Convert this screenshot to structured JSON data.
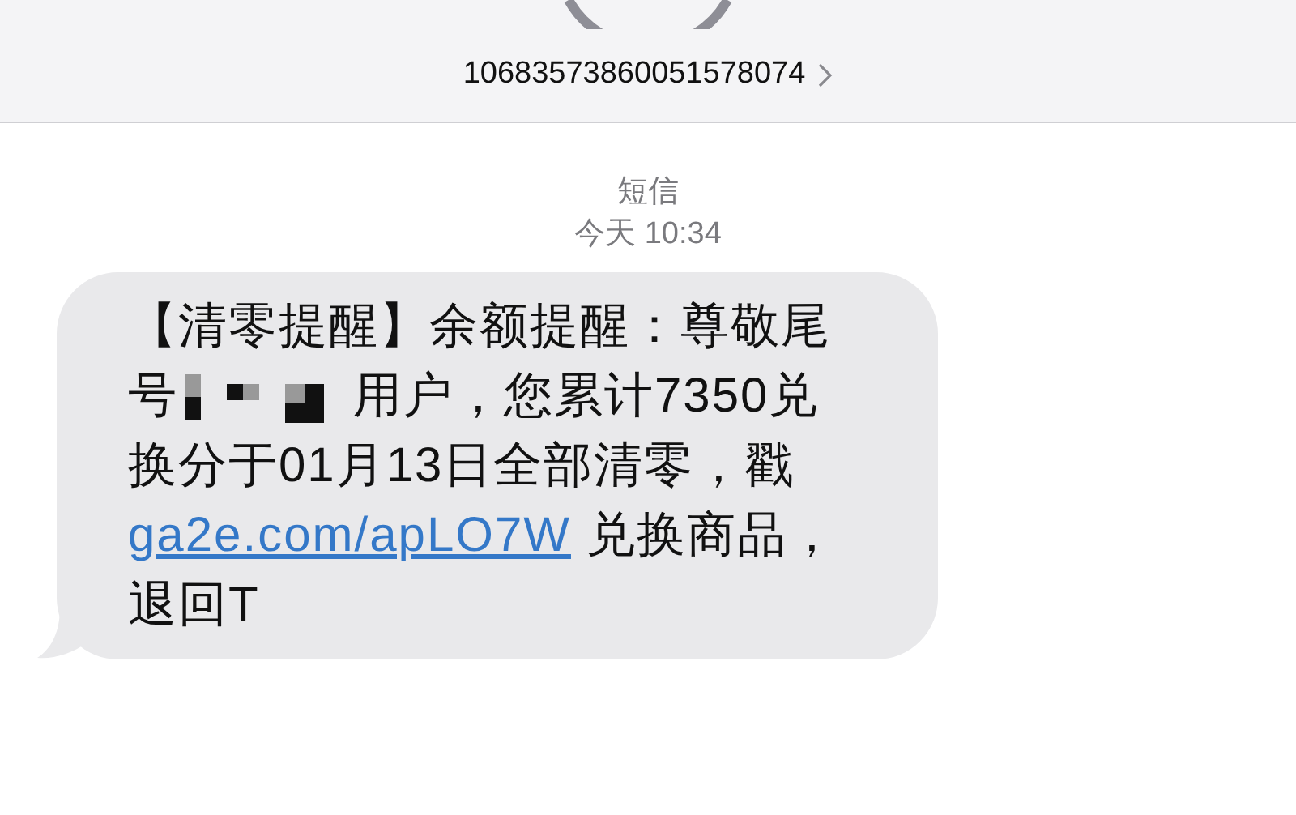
{
  "header": {
    "sender": "10683573860051578074"
  },
  "thread": {
    "service": "短信",
    "timestamp": "今天 10:34"
  },
  "message": {
    "parts": [
      {
        "kind": "text",
        "text": "【清零提醒】余额提醒：尊敬尾号"
      },
      {
        "kind": "redaction"
      },
      {
        "kind": "text",
        "text": "用户，您累计7350兑换分于01月13日全部清零，戳 "
      },
      {
        "kind": "link",
        "text": "ga2e.com/apLO7W"
      },
      {
        "kind": "text",
        "text": " 兑换商品，退回T"
      }
    ]
  }
}
